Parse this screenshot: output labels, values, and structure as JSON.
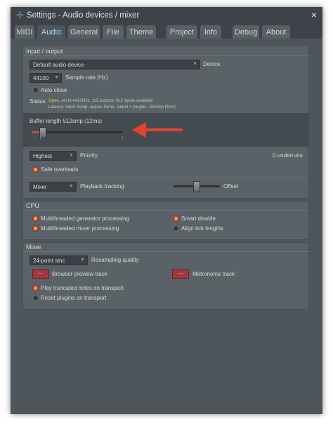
{
  "window": {
    "title": "Settings - Audio devices / mixer",
    "close_label": "×"
  },
  "tabs": [
    "MIDI",
    "Audio",
    "General",
    "File",
    "Theme",
    "Project",
    "Info",
    "Debug",
    "About"
  ],
  "io": {
    "section_title": "Input / output",
    "device_value": "Default audio device",
    "device_label": "Device",
    "sample_rate_value": "44100",
    "sample_rate_label": "Sample rate (Hz)",
    "auto_close_label": "Auto close",
    "status_label": "Status",
    "status_open": "Open",
    "status_line1": ", set to 44100Hz, 1x2 outputs, 0x2 inputs available",
    "status_line2": "Latency: input: 0smp, output: 0smp, output + plugins: 156smp (4ms)",
    "buffer_label": "Buffer length 512smp (12ms)",
    "buffer_level": 0.12,
    "priority_value": "Highest",
    "priority_label": "Priority",
    "underruns": "0 underruns",
    "safe_overloads_label": "Safe overloads",
    "playback_value": "Mixer",
    "playback_label": "Playback tracking",
    "offset_label": "Offset",
    "offset_level": 0.5
  },
  "cpu": {
    "section_title": "CPU",
    "multi_gen": "Multithreaded generator processing",
    "multi_mix": "Multithreaded mixer processing",
    "smart_disable": "Smart disable",
    "align_ticks": "Align tick lengths"
  },
  "mixer": {
    "section_title": "Mixer",
    "resampling_value": "24-point sinc",
    "resampling_label": "Resampling quality",
    "browser_preview_toggle": "---",
    "browser_preview_label": "Browser preview track",
    "metronome_toggle": "---",
    "metronome_label": "Metronome track",
    "play_truncated": "Play truncated notes on transport",
    "reset_plugins": "Reset plugins on transport"
  },
  "colors": {
    "accent": "#9fd7ff",
    "status_open": "#e9c94a",
    "arrow": "#e0442f",
    "toggle": "#a6353c"
  }
}
